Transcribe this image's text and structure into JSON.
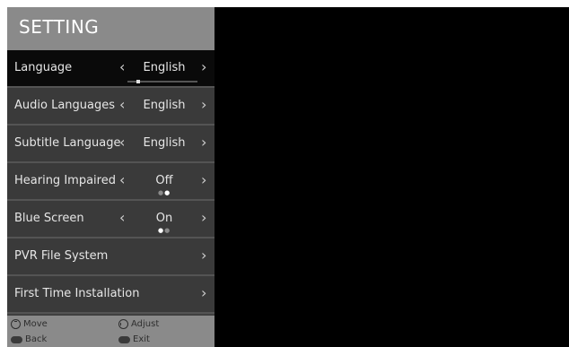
{
  "menu": {
    "title": "SETTING",
    "items": [
      {
        "label": "Language",
        "value": "English",
        "left_arrow": "‹",
        "right_arrow": "›",
        "progress_fraction": 0.14
      },
      {
        "label": "Audio Languages",
        "value": "English",
        "left_arrow": "‹",
        "right_arrow": "›"
      },
      {
        "label": "Subtitle Language",
        "value": "English",
        "left_arrow": "‹",
        "right_arrow": "›"
      },
      {
        "label": "Hearing Impaired",
        "value": "Off",
        "left_arrow": "‹",
        "right_arrow": "›",
        "option_index": 2,
        "option_count": 2
      },
      {
        "label": "Blue Screen",
        "value": "On",
        "left_arrow": "‹",
        "right_arrow": "›",
        "option_index": 1,
        "option_count": 2
      },
      {
        "label": "PVR File System",
        "right_arrow": "›"
      },
      {
        "label": "First Time Installation",
        "right_arrow": "›"
      }
    ]
  },
  "footer": {
    "move": {
      "icon": "dpad-vertical-icon",
      "label": "Move"
    },
    "adjust": {
      "icon": "dpad-horizontal-icon",
      "label": "Adjust"
    },
    "back": {
      "icon": "menu-key-icon",
      "key": "MENU",
      "label": "Back"
    },
    "exit": {
      "icon": "exit-key-icon",
      "key": "EXIT",
      "label": "Exit"
    }
  },
  "colors": {
    "header_bg": "#8a8a8a",
    "row_bg": "#3a3a3a",
    "selected_row_bg": "#0a0a0a",
    "text": "#e6e6e6",
    "screen_bg": "#000000"
  }
}
